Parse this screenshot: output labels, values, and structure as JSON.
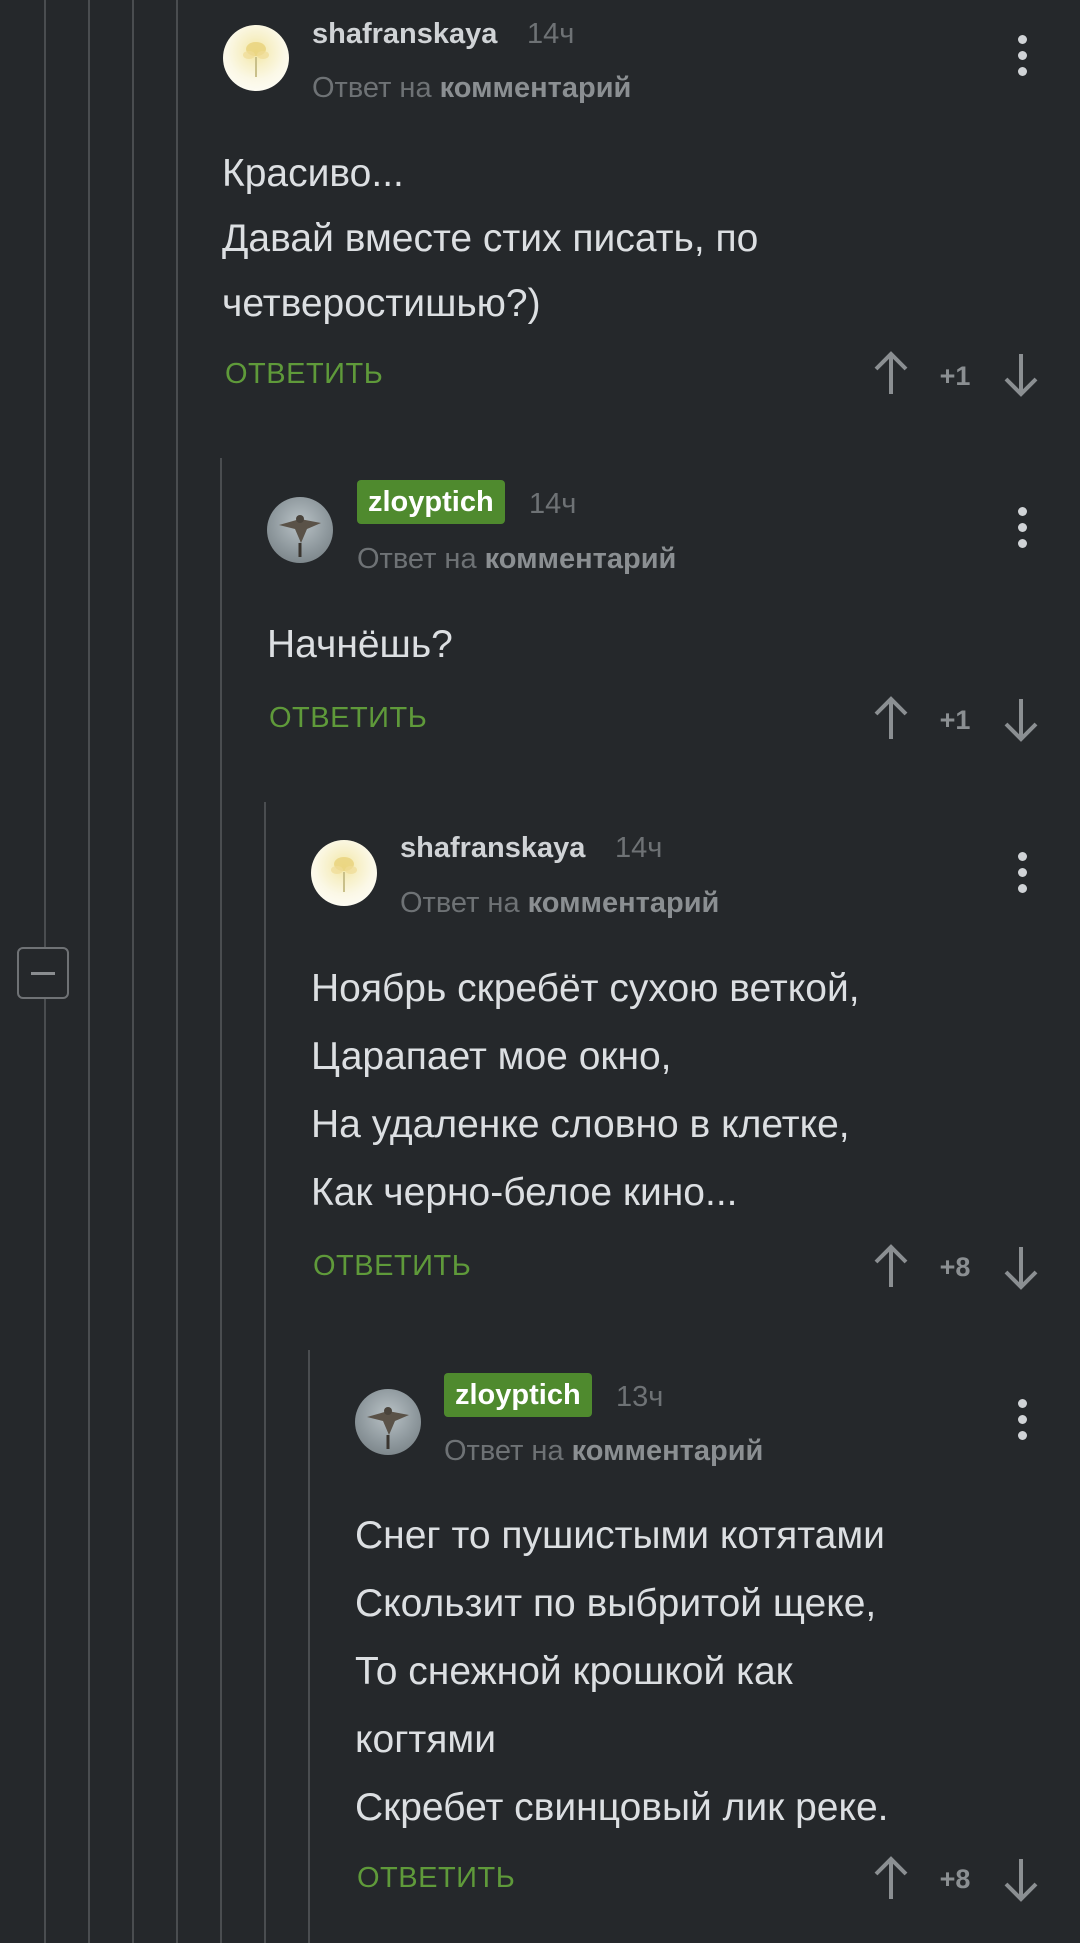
{
  "comments": [
    {
      "username": "shafranskaya",
      "time": "14ч",
      "reply_prefix": "Ответ на",
      "reply_target": "комментарий",
      "lines": [
        "Красиво...",
        "Давай вместе стих писать, по",
        "четверостишью?)"
      ],
      "reply_label": "ОТВЕТИТЬ",
      "score": "+1",
      "avatar_icon": "flower-avatar"
    },
    {
      "username": "zloyptich",
      "time": "14ч",
      "reply_prefix": "Ответ на",
      "reply_target": "комментарий",
      "lines": [
        "Начнёшь?"
      ],
      "reply_label": "ОТВЕТИТЬ",
      "score": "+1",
      "avatar_icon": "bird-avatar",
      "badge_color": "#4f8a2e"
    },
    {
      "username": "shafranskaya",
      "time": "14ч",
      "reply_prefix": "Ответ на",
      "reply_target": "комментарий",
      "lines": [
        "Ноябрь скребёт сухою веткой,",
        "Царапает мое окно,",
        "На удаленке словно в клетке,",
        "Как черно-белое кино..."
      ],
      "reply_label": "ОТВЕТИТЬ",
      "score": "+8",
      "avatar_icon": "flower-avatar"
    },
    {
      "username": "zloyptich",
      "time": "13ч",
      "reply_prefix": "Ответ на",
      "reply_target": "комментарий",
      "lines": [
        "Снег то пушистыми котятами",
        "Скользит по выбритой щеке,",
        "То снежной крошкой как",
        "когтями",
        "Скребет свинцовый лик реке."
      ],
      "reply_label": "ОТВЕТИТЬ",
      "score": "+8",
      "avatar_icon": "bird-avatar",
      "badge_color": "#4f8a2e"
    }
  ],
  "icons": {
    "upvote": "arrow-up-icon",
    "downvote": "arrow-down-icon",
    "more": "more-vertical-icon",
    "collapse": "minus-icon"
  }
}
